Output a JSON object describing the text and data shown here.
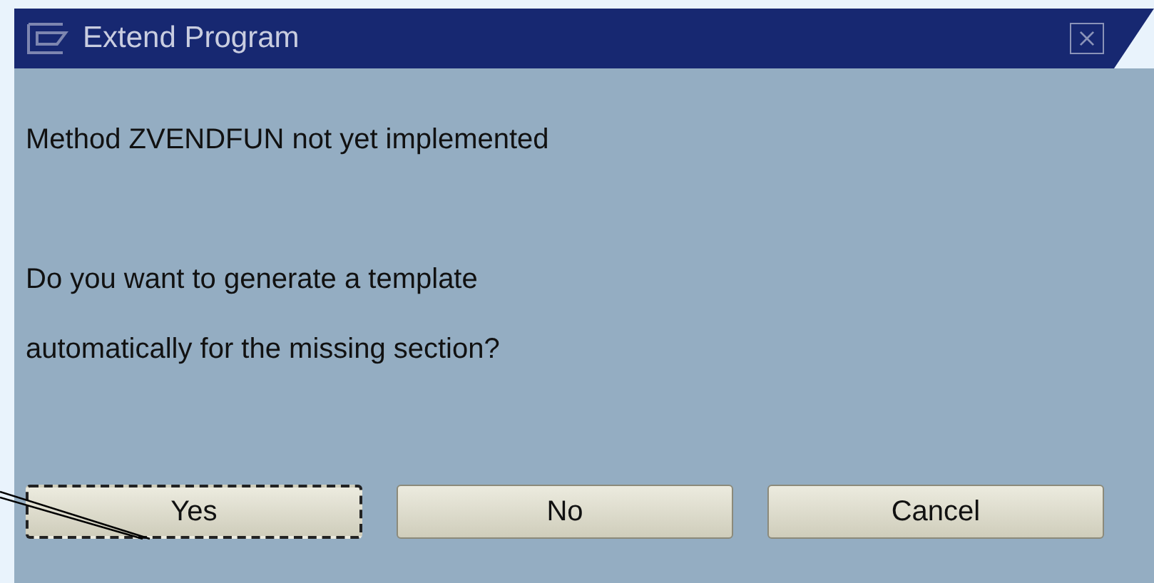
{
  "window": {
    "title": "Extend Program"
  },
  "messages": [
    "Method ZVENDFUN not yet implemented",
    "Do you want to generate a template\nautomatically for the missing section?"
  ],
  "buttons": [
    {
      "label": "Yes",
      "focused": true
    },
    {
      "label": "No",
      "focused": false
    },
    {
      "label": "Cancel",
      "focused": false
    }
  ]
}
